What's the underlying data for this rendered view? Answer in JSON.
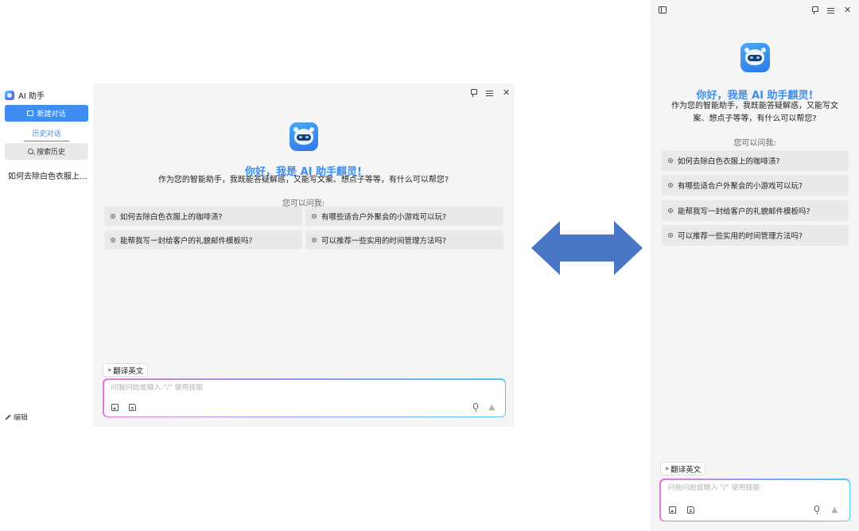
{
  "app": {
    "title": "AI 助手"
  },
  "sidebar": {
    "new_chat_label": "新建对话",
    "history_tab_label": "历史对话",
    "search_history_label": "搜索历史",
    "history_items": [
      "如何去除白色衣服上…"
    ],
    "edit_label": "编辑"
  },
  "welcome": {
    "greeting": "你好，我是 AI 助手麒灵!",
    "intro": "作为您的智能助手，我既能答疑解惑，又能写文案、想点子等等，有什么可以帮您?",
    "ask_label": "您可以问我:",
    "suggestions": [
      "如何去除白色衣服上的咖啡渍?",
      "有哪些适合户外聚会的小游戏可以玩?",
      "能帮我写一封给客户的礼貌邮件模板吗?",
      "可以推荐一些实用的时间管理方法吗?"
    ]
  },
  "input": {
    "skill_chip_label": "翻译英文",
    "placeholder": "问我问题或输入 \"/\" 使用技能"
  },
  "colors": {
    "accent": "#3f8cf2",
    "greeting": "#3b8ef0",
    "arrow": "#4a76c8",
    "panel_bg": "#f5f5f6",
    "chip_bg": "#e9e9eb"
  },
  "icons": {
    "pin": "pin-icon",
    "menu": "menu-icon",
    "close": "close-icon",
    "panel_toggle": "sidebar-toggle-icon",
    "image": "image-icon",
    "file": "file-icon",
    "mic": "mic-icon",
    "send": "send-icon"
  }
}
